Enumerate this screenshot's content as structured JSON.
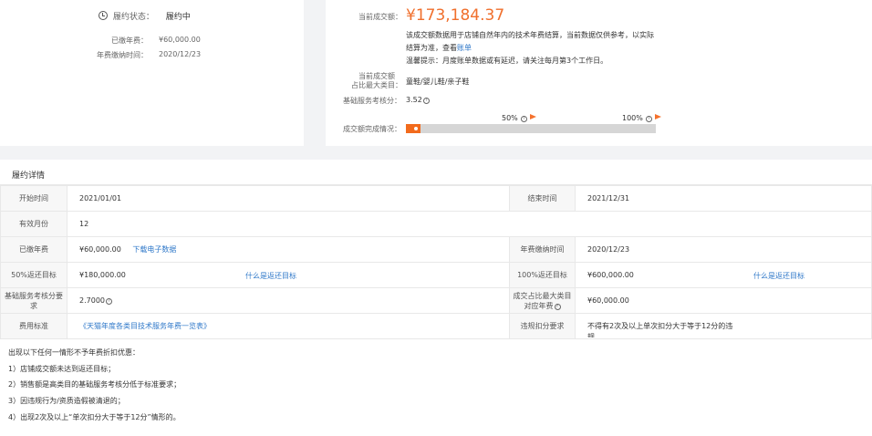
{
  "left_panel": {
    "status_label": "履约状态：",
    "status_value": "履约中",
    "paid_fee_label": "已缴年费：",
    "paid_fee_value": "¥60,000.00",
    "fee_time_label": "年费缴纳时间：",
    "fee_time_value": "2020/12/23"
  },
  "right_panel": {
    "turnover_label": "当前成交额：",
    "turnover_value": "¥173,184.37",
    "note_line1": "该成交额数据用于店铺自然年内的技术年费结算，当前数据仅供参考，以实际",
    "note_line2_prefix": "结算为准，查看",
    "note_line2_link": "账单",
    "note_line3": "温馨提示：月度账单数据或有延迟，请关注每月第3个工作日。",
    "category_label_1": "当前成交额",
    "category_label_2": "占比最大类目：",
    "category_value": "童鞋/婴儿鞋/亲子鞋",
    "score_label": "基础服务考核分：",
    "score_value": "3.52",
    "progress_label": "成交额完成情况：",
    "progress_fraction": 0.06,
    "marker_50": "50%",
    "marker_100": "100%"
  },
  "details": {
    "title": "履约详情",
    "rows": {
      "start_label": "开始时间",
      "start_value": "2021/01/01",
      "end_label": "结束时间",
      "end_value": "2021/12/31",
      "months_label": "有效月份",
      "months_value": "12",
      "paid_label": "已缴年费",
      "paid_value": "¥60,000.00",
      "paid_link": "下载电子数据",
      "fee_time_label": "年费缴纳时间",
      "fee_time_value": "2020/12/23",
      "refund50_label": "50%返还目标",
      "refund50_value": "¥180,000.00",
      "refund50_link": "什么是返还目标",
      "refund100_label": "100%返还目标",
      "refund100_value": "¥600,000.00",
      "refund100_link": "什么是返还目标",
      "score_req_label_1": "基础服务考核分要",
      "score_req_label_2": "求",
      "score_req_value": "2.7000",
      "cat_fee_label_1": "成交占比最大类目",
      "cat_fee_label_2": "对应年费",
      "cat_fee_value": "¥60,000.00",
      "standard_label": "费用标准",
      "standard_link": "《天猫年度各类目技术服务年费一览表》",
      "violation_label": "违规扣分要求",
      "violation_value_1": "不得有2次及以上单次扣分大于等于12分的违",
      "violation_value_2": "规"
    }
  },
  "conditions": {
    "intro": "出现以下任何一情形不予年费折扣优惠：",
    "items": [
      "1）店铺成交额未达到返还目标；",
      "2）销售额是高类目的基础服务考核分低于标准要求；",
      "3）因违规行为/资质造假被清退的；",
      "4）出现2次及以上“单次扣分大于等于12分”情形的。"
    ]
  }
}
